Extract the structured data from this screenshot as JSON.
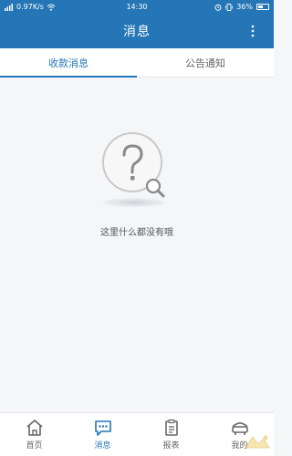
{
  "status_bar": {
    "network_speed": "0.97K/s",
    "time": "14:30",
    "battery_percent": "36%",
    "icons": [
      "signal-icon",
      "wifi-icon",
      "alarm-icon",
      "vibrate-icon",
      "battery-icon"
    ]
  },
  "header": {
    "title": "消息",
    "more_icon": "more-vertical-icon"
  },
  "tabs": [
    {
      "label": "收款消息",
      "active": true
    },
    {
      "label": "公告通知",
      "active": false
    }
  ],
  "empty_state": {
    "text": "这里什么都没有哦",
    "icon": "question-search-icon"
  },
  "bottom_nav": [
    {
      "label": "首页",
      "icon": "home-icon",
      "active": false
    },
    {
      "label": "消息",
      "icon": "message-icon",
      "active": true
    },
    {
      "label": "报表",
      "icon": "report-icon",
      "active": false
    },
    {
      "label": "我的",
      "icon": "profile-icon",
      "active": false
    }
  ],
  "colors": {
    "primary": "#2576b6",
    "background": "#f5f6f8",
    "text": "#555555"
  }
}
